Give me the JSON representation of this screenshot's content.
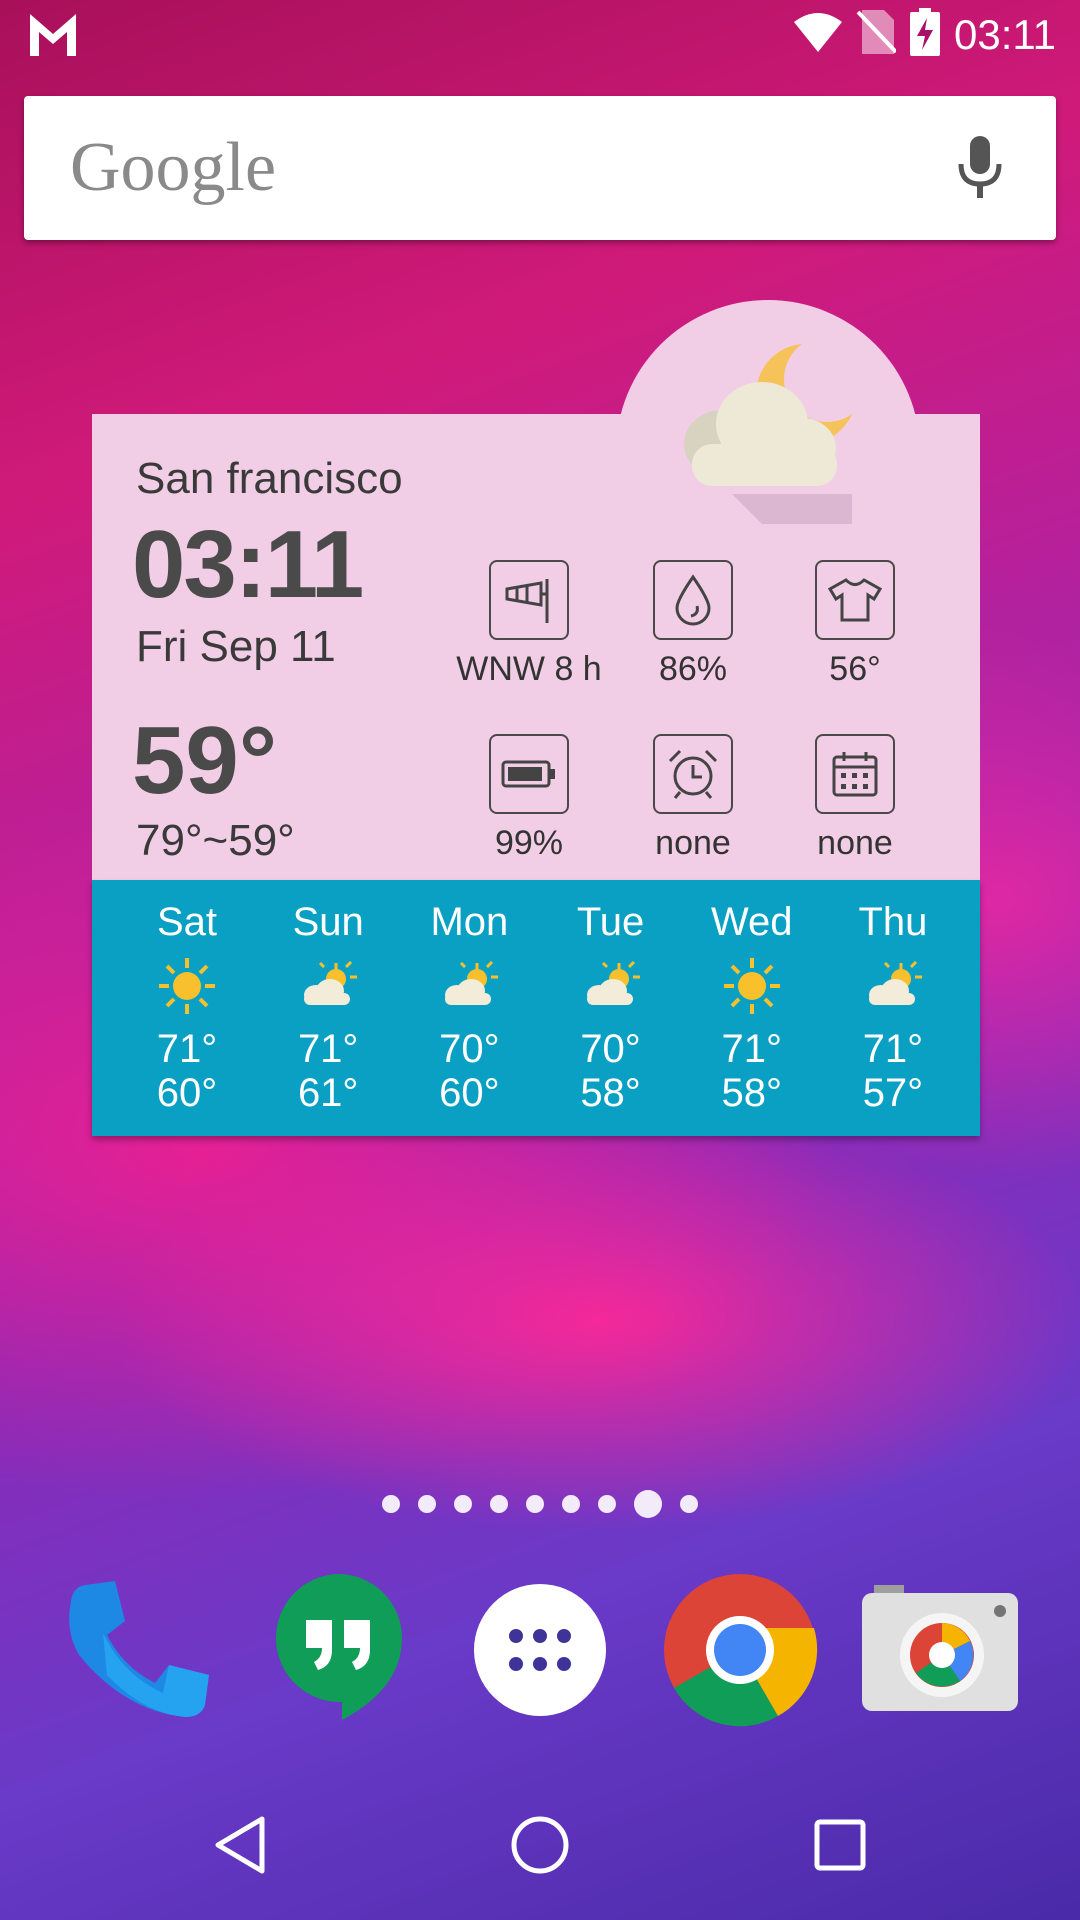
{
  "status_bar": {
    "time": "03:11",
    "left_icon": "gmail-m-icon",
    "icons": [
      "wifi-icon",
      "no-sim-icon",
      "battery-charging-icon"
    ]
  },
  "search": {
    "logo_text": "Google",
    "mic_icon": "mic-icon"
  },
  "widget": {
    "city": "San francisco",
    "time": "03:11",
    "date": "Fri Sep 11",
    "temperature": "59°",
    "range": "79°~59°",
    "condition_icon": "cloud-moon-icon",
    "stats": [
      {
        "icon": "windsock-icon",
        "value": "WNW 8 h"
      },
      {
        "icon": "humidity-drop-icon",
        "value": "86%"
      },
      {
        "icon": "shirt-icon",
        "value": "56°"
      },
      {
        "icon": "battery-icon",
        "value": "99%"
      },
      {
        "icon": "alarm-clock-icon",
        "value": "none"
      },
      {
        "icon": "calendar-icon",
        "value": "none"
      }
    ],
    "forecast": [
      {
        "day": "Sat",
        "icon": "sun-icon",
        "high": "71°",
        "low": "60°"
      },
      {
        "day": "Sun",
        "icon": "partly-cloudy-icon",
        "high": "71°",
        "low": "61°"
      },
      {
        "day": "Mon",
        "icon": "partly-cloudy-icon",
        "high": "70°",
        "low": "60°"
      },
      {
        "day": "Tue",
        "icon": "partly-cloudy-icon",
        "high": "70°",
        "low": "58°"
      },
      {
        "day": "Wed",
        "icon": "sun-icon",
        "high": "71°",
        "low": "58°"
      },
      {
        "day": "Thu",
        "icon": "partly-cloudy-icon",
        "high": "71°",
        "low": "57°"
      }
    ]
  },
  "page_indicator": {
    "count": 9,
    "active_index": 7
  },
  "dock": [
    "phone-icon",
    "hangouts-icon",
    "app-drawer-icon",
    "chrome-icon",
    "camera-icon"
  ],
  "nav": [
    "back-icon",
    "home-icon",
    "recents-icon"
  ],
  "colors": {
    "widget_bg": "#f2cee6",
    "forecast_bg": "#0aa0c4",
    "sun": "#f8c02c"
  }
}
